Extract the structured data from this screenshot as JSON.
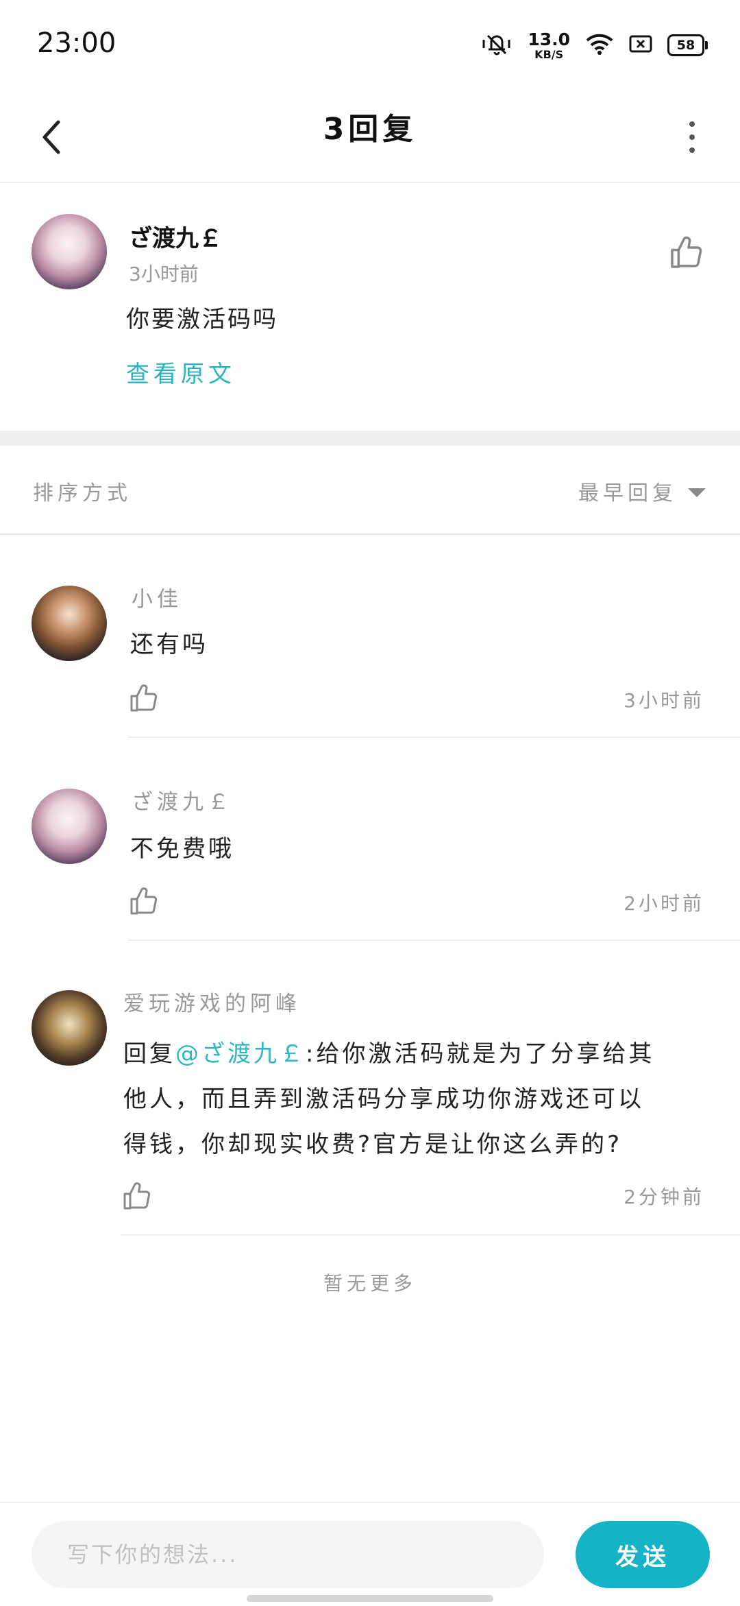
{
  "status_bar": {
    "time": "23:00",
    "net_speed_value": "13.0",
    "net_speed_unit": "KB/S",
    "battery": "58",
    "icons": [
      "mute-bell-icon",
      "wifi-icon",
      "sim-card-icon",
      "battery-icon"
    ]
  },
  "nav": {
    "title": "3回复",
    "back_icon": "chevron-left-icon",
    "more_icon": "more-vertical-icon"
  },
  "main_comment": {
    "author": "ざ渡九￡",
    "time": "3小时前",
    "text": "你要激活码吗",
    "view_original": "查看原文",
    "like_icon": "thumbs-up-icon"
  },
  "sort": {
    "label": "排序方式",
    "value": "最早回复"
  },
  "replies": [
    {
      "author": "小佳",
      "text": "还有吗",
      "time": "3小时前"
    },
    {
      "author": "ざ渡九￡",
      "text": "不免费哦",
      "time": "2小时前"
    },
    {
      "author": "爱玩游戏的阿峰",
      "reply_prefix": "回复",
      "reply_mention": "@ざ渡九￡",
      "text_line1": ":给你激活码就是为了分享给其",
      "text_line2": "他人，而且弄到激活码分享成功你游戏还可以",
      "text_line3": "得钱，你却现实收费?官方是让你这么弄的?",
      "time": "2分钟前"
    }
  ],
  "no_more": "暂无更多",
  "input": {
    "placeholder": "写下你的想法..."
  },
  "send_label": "发送",
  "colors": {
    "accent": "#16b3c6",
    "link": "#29b3c2",
    "muted": "#999999"
  }
}
